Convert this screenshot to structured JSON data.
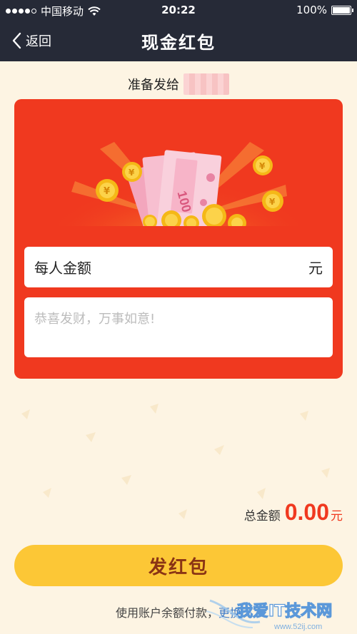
{
  "status_bar": {
    "carrier": "中国移动",
    "time": "20:22",
    "battery": "100%"
  },
  "nav": {
    "back_label": "返回",
    "title": "现金红包"
  },
  "recipient": {
    "label": "准备发给"
  },
  "form": {
    "amount_label": "每人金额",
    "amount_unit": "元",
    "message_placeholder": "恭喜发财，万事如意!"
  },
  "illustration": {
    "banknote_text": "100"
  },
  "total": {
    "label": "总金额",
    "amount": "0.00",
    "unit": "元"
  },
  "send_button_label": "发红包",
  "footer": {
    "note": "使用账户余额付款，",
    "change_link": "更换"
  },
  "watermark": {
    "text": "我爱IT技术网",
    "url": "www.52ij.com"
  },
  "colors": {
    "header_bg": "#262a37",
    "card_red": "#f0391f",
    "button_yellow": "#fcc736",
    "page_bg": "#fdf4e3",
    "link_blue": "#3b79c8"
  }
}
